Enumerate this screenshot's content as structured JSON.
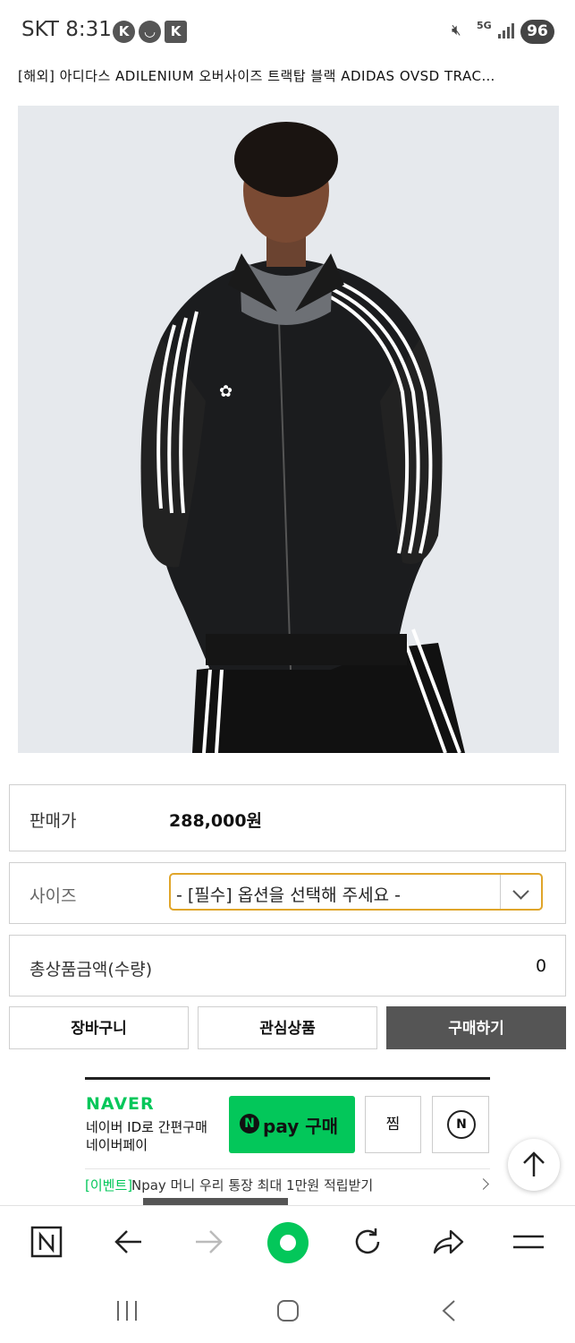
{
  "status_bar": {
    "carrier": "SKT",
    "time": "8:31",
    "network": "5G",
    "battery": "96"
  },
  "product": {
    "title": "[해외] 아디다스 ADILENIUM 오버사이즈 트랙탑 블랙 ADIDAS OVSD TRAC…",
    "image_alt": "black oversized adidas track jacket with white stripes"
  },
  "price_row": {
    "label": "판매가",
    "value": "288,000원"
  },
  "size_row": {
    "label": "사이즈",
    "placeholder": "- [필수] 옵션을 선택해 주세요 -"
  },
  "total_row": {
    "label": "총상품금액(수량)",
    "value": "0"
  },
  "buttons": {
    "cart": "장바구니",
    "wishlist": "관심상품",
    "buy": "구매하기"
  },
  "naver": {
    "logo": "NAVER",
    "desc_line1": "네이버 ID로 간편구매",
    "desc_line2": "네이버페이",
    "pay_n": "N",
    "pay_label": "pay 구매",
    "zzim": "찜",
    "talk_n": "N",
    "event_tag": "[이벤트]",
    "event_text": "Npay 머니 우리 통장 최대 1만원 적립받기"
  },
  "colors": {
    "accent": "#e0a52a",
    "naver_green": "#03c75a",
    "buy_button": "#555555"
  }
}
